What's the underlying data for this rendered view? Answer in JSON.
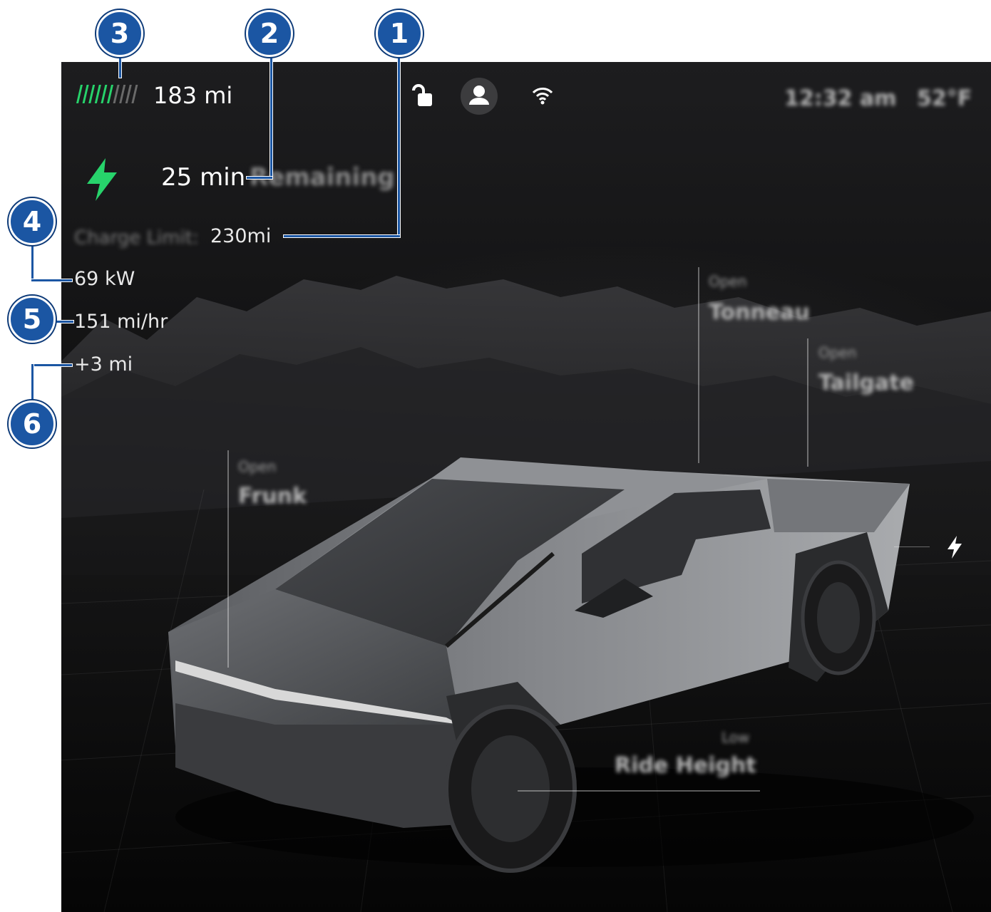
{
  "status_bar": {
    "range": "183 mi",
    "battery_level_fraction": 0.6,
    "time": "12:32 am",
    "temperature": "52°F"
  },
  "charging": {
    "time_remaining_value": "25 min",
    "time_remaining_label": "Remaining",
    "charge_limit_label": "Charge Limit:",
    "charge_limit_value": "230mi",
    "power": "69 kW",
    "rate": "151 mi/hr",
    "added_range": "+3 mi"
  },
  "vehicle_controls": {
    "tonneau": {
      "state": "Open",
      "label": "Tonneau"
    },
    "tailgate": {
      "state": "Open",
      "label": "Tailgate"
    },
    "frunk": {
      "state": "Open",
      "label": "Frunk"
    },
    "ride_height": {
      "state": "Low",
      "label": "Ride Height"
    }
  },
  "callouts": [
    "1",
    "2",
    "3",
    "4",
    "5",
    "6"
  ],
  "colors": {
    "accent_green": "#27d36b",
    "callout_blue": "#1b56a3",
    "screen_bg": "#141415"
  },
  "icons": [
    "charging-bolt-icon",
    "unlock-icon",
    "profile-icon",
    "wifi-icon",
    "charge-port-icon"
  ]
}
